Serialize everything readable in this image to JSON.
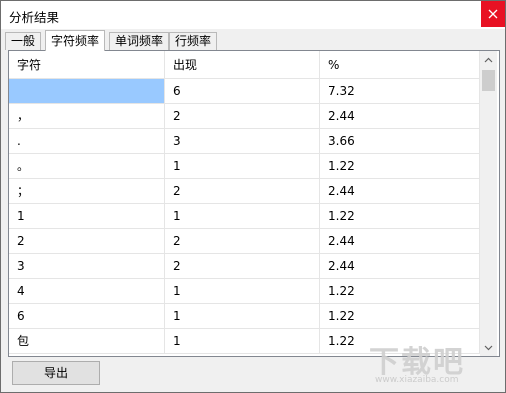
{
  "window": {
    "title": "分析结果"
  },
  "tabs": [
    {
      "label": "一般",
      "active": false
    },
    {
      "label": "字符频率",
      "active": true
    },
    {
      "label": "单词频率",
      "active": false
    },
    {
      "label": "行频率",
      "active": false
    }
  ],
  "table": {
    "columns": [
      "字符",
      "出现",
      "%"
    ],
    "rows": [
      {
        "char": "",
        "count": "6",
        "percent": "7.32",
        "selected": true
      },
      {
        "char": "，",
        "count": "2",
        "percent": "2.44"
      },
      {
        "char": ".",
        "count": "3",
        "percent": "3.66"
      },
      {
        "char": "。",
        "count": "1",
        "percent": "1.22"
      },
      {
        "char": "；",
        "count": "2",
        "percent": "2.44"
      },
      {
        "char": "1",
        "count": "1",
        "percent": "1.22"
      },
      {
        "char": "2",
        "count": "2",
        "percent": "2.44"
      },
      {
        "char": "3",
        "count": "2",
        "percent": "2.44"
      },
      {
        "char": "4",
        "count": "1",
        "percent": "1.22"
      },
      {
        "char": "6",
        "count": "1",
        "percent": "1.22"
      },
      {
        "char": "包",
        "count": "1",
        "percent": "1.22"
      }
    ]
  },
  "buttons": {
    "export_label": "导出"
  },
  "watermark": {
    "main": "下载吧",
    "sub": "www.xiazaiba.com"
  },
  "colors": {
    "selection": "#99c9ff",
    "close_bg": "#e81123"
  }
}
